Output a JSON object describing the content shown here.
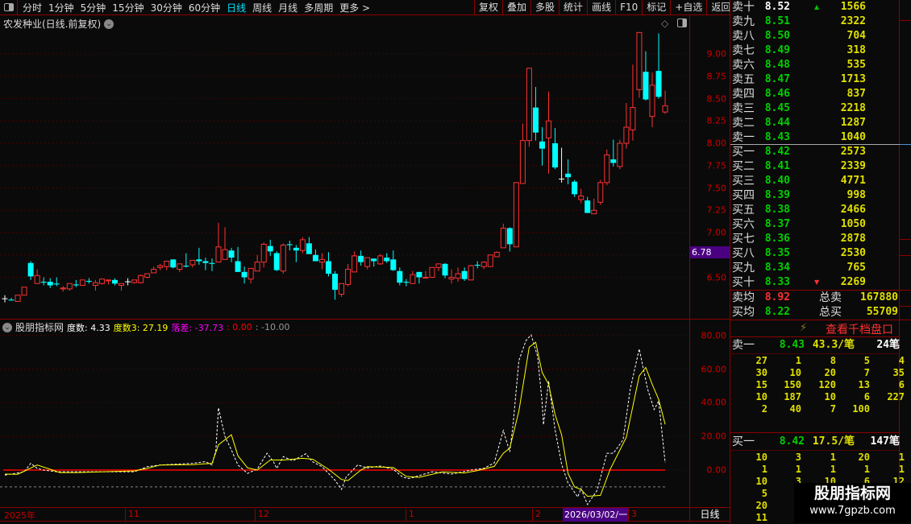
{
  "toolbar": {
    "periods": [
      "分时",
      "1分钟",
      "5分钟",
      "15分钟",
      "30分钟",
      "60分钟",
      "日线",
      "周线",
      "月线",
      "多周期",
      "更多 >"
    ],
    "active_period": "日线",
    "buttons": [
      "复权",
      "叠加",
      "多股",
      "统计",
      "画线",
      "F10",
      "标记",
      "+自选",
      "返回"
    ]
  },
  "chart": {
    "title": "农发种业(日线.前复权)",
    "price_ticks": [
      "9.00",
      "8.75",
      "8.50",
      "8.25",
      "8.00",
      "7.75",
      "7.50",
      "7.25",
      "7.00",
      "6.75",
      "6.50"
    ],
    "price_tick_values": [
      9.0,
      8.75,
      8.5,
      8.25,
      8.0,
      7.75,
      7.5,
      7.25,
      7.0,
      6.75,
      6.5
    ],
    "current_price_label": "6.78",
    "current_price_value": 6.78,
    "colors": {
      "up": "#ff3232",
      "down": "#00ffff",
      "flat": "#ffffff"
    },
    "candles_ohlc": [
      [
        6.26,
        6.3,
        6.22,
        6.26
      ],
      [
        6.25,
        6.27,
        6.24,
        6.24
      ],
      [
        6.23,
        6.3,
        6.23,
        6.3
      ],
      [
        6.3,
        6.39,
        6.3,
        6.39
      ],
      [
        6.66,
        6.68,
        6.47,
        6.51
      ],
      [
        6.43,
        6.59,
        6.43,
        6.52
      ],
      [
        6.45,
        6.5,
        6.41,
        6.44
      ],
      [
        6.45,
        6.49,
        6.38,
        6.41
      ],
      [
        6.43,
        6.5,
        6.4,
        6.42
      ],
      [
        6.37,
        6.4,
        6.34,
        6.38
      ],
      [
        6.37,
        6.43,
        6.35,
        6.43
      ],
      [
        6.42,
        6.47,
        6.39,
        6.41
      ],
      [
        6.41,
        6.47,
        6.41,
        6.47
      ],
      [
        6.46,
        6.49,
        6.43,
        6.45
      ],
      [
        6.41,
        6.47,
        6.35,
        6.44
      ],
      [
        6.43,
        6.48,
        6.42,
        6.48
      ],
      [
        6.46,
        6.47,
        6.42,
        6.47
      ],
      [
        6.47,
        6.49,
        6.41,
        6.43
      ],
      [
        6.41,
        6.43,
        6.35,
        6.43
      ],
      [
        6.45,
        6.49,
        6.41,
        6.45
      ],
      [
        6.44,
        6.47,
        6.43,
        6.47
      ],
      [
        6.44,
        6.53,
        6.43,
        6.52
      ],
      [
        6.5,
        6.54,
        6.49,
        6.54
      ],
      [
        6.55,
        6.62,
        6.55,
        6.59
      ],
      [
        6.61,
        6.65,
        6.58,
        6.63
      ],
      [
        6.62,
        6.68,
        6.58,
        6.68
      ],
      [
        6.7,
        6.7,
        6.6,
        6.61
      ],
      [
        6.59,
        6.65,
        6.56,
        6.65
      ],
      [
        6.63,
        6.77,
        6.61,
        6.62
      ],
      [
        6.64,
        6.69,
        6.61,
        6.69
      ],
      [
        6.7,
        6.83,
        6.64,
        6.68
      ],
      [
        6.68,
        6.72,
        6.58,
        6.66
      ],
      [
        6.66,
        6.71,
        6.57,
        6.65
      ],
      [
        6.67,
        7.11,
        6.67,
        6.84
      ],
      [
        6.7,
        7.06,
        6.7,
        6.81
      ],
      [
        6.8,
        6.83,
        6.67,
        6.72
      ],
      [
        6.68,
        6.84,
        6.56,
        6.56
      ],
      [
        6.56,
        6.62,
        6.43,
        6.5
      ],
      [
        6.48,
        6.6,
        6.43,
        6.6
      ],
      [
        6.57,
        6.75,
        6.57,
        6.67
      ],
      [
        6.67,
        6.89,
        6.61,
        6.87
      ],
      [
        6.85,
        6.92,
        6.74,
        6.79
      ],
      [
        6.77,
        6.79,
        6.57,
        6.58
      ],
      [
        6.57,
        6.88,
        6.54,
        6.86
      ],
      [
        6.87,
        6.91,
        6.8,
        6.86
      ],
      [
        6.83,
        6.86,
        6.67,
        6.8
      ],
      [
        6.8,
        6.95,
        6.77,
        6.92
      ],
      [
        6.88,
        6.95,
        6.76,
        6.76
      ],
      [
        6.75,
        6.81,
        6.68,
        6.68
      ],
      [
        6.67,
        6.77,
        6.59,
        6.7
      ],
      [
        6.68,
        6.78,
        6.51,
        6.54
      ],
      [
        6.54,
        6.57,
        6.25,
        6.36
      ],
      [
        6.31,
        6.43,
        6.28,
        6.43
      ],
      [
        6.42,
        6.65,
        6.4,
        6.59
      ],
      [
        6.56,
        6.79,
        6.56,
        6.74
      ],
      [
        6.74,
        6.8,
        6.63,
        6.67
      ],
      [
        6.62,
        6.72,
        6.59,
        6.72
      ],
      [
        6.71,
        6.71,
        6.62,
        6.68
      ],
      [
        6.65,
        6.76,
        6.64,
        6.74
      ],
      [
        6.72,
        6.77,
        6.66,
        6.68
      ],
      [
        6.7,
        6.8,
        6.57,
        6.58
      ],
      [
        6.57,
        6.61,
        6.41,
        6.44
      ],
      [
        6.45,
        6.48,
        6.4,
        6.44
      ],
      [
        6.43,
        6.57,
        6.43,
        6.53
      ],
      [
        6.56,
        6.56,
        6.43,
        6.5
      ],
      [
        6.49,
        6.57,
        6.49,
        6.5
      ],
      [
        6.5,
        6.61,
        6.5,
        6.61
      ],
      [
        6.61,
        6.65,
        6.57,
        6.65
      ],
      [
        6.65,
        6.66,
        6.49,
        6.52
      ],
      [
        6.48,
        6.59,
        6.43,
        6.5
      ],
      [
        6.49,
        6.61,
        6.45,
        6.54
      ],
      [
        6.57,
        6.61,
        6.46,
        6.48
      ],
      [
        6.47,
        6.64,
        6.47,
        6.63
      ],
      [
        6.64,
        6.68,
        6.6,
        6.63
      ],
      [
        6.62,
        6.68,
        6.59,
        6.67
      ],
      [
        6.62,
        6.75,
        6.62,
        6.75
      ],
      [
        6.73,
        6.79,
        6.73,
        6.78
      ],
      [
        6.83,
        7.1,
        6.83,
        7.05
      ],
      [
        7.05,
        7.06,
        6.79,
        6.87
      ],
      [
        6.84,
        7.56,
        6.84,
        7.56
      ],
      [
        7.55,
        8.22,
        7.55,
        8.03
      ],
      [
        8.03,
        8.84,
        7.96,
        8.84
      ],
      [
        8.4,
        8.63,
        8.03,
        8.12
      ],
      [
        8.02,
        8.18,
        7.75,
        7.94
      ],
      [
        8.06,
        8.58,
        7.66,
        8.25
      ],
      [
        8.0,
        8.17,
        7.71,
        7.73
      ],
      [
        7.6,
        7.95,
        7.56,
        7.6
      ],
      [
        7.66,
        7.82,
        7.54,
        7.62
      ],
      [
        7.57,
        7.59,
        7.4,
        7.43
      ],
      [
        7.37,
        7.49,
        7.33,
        7.41
      ],
      [
        7.36,
        7.4,
        7.22,
        7.22
      ],
      [
        7.21,
        7.38,
        7.21,
        7.25
      ],
      [
        7.34,
        7.59,
        7.31,
        7.56
      ],
      [
        7.56,
        7.93,
        7.53,
        7.87
      ],
      [
        7.82,
        8.04,
        7.74,
        7.78
      ],
      [
        7.74,
        8.04,
        7.71,
        8.0
      ],
      [
        8.0,
        8.45,
        7.94,
        8.18
      ],
      [
        8.15,
        8.88,
        8.03,
        8.4
      ],
      [
        8.6,
        9.24,
        8.51,
        9.24
      ],
      [
        8.8,
        9.03,
        8.48,
        8.49
      ],
      [
        8.3,
        8.79,
        8.18,
        8.65
      ],
      [
        8.81,
        9.23,
        8.5,
        8.52
      ],
      [
        8.35,
        8.59,
        8.33,
        8.42
      ]
    ]
  },
  "indicator": {
    "name": "股朋指标网",
    "items": [
      {
        "text": "度数: 4.33",
        "color": "#ffffff"
      },
      {
        "text": "度数3: 27.19",
        "color": "#ffff00"
      },
      {
        "text": "落差: -37.73",
        "color": "#ff00ff"
      },
      {
        "text": ": 0.00",
        "color": "#ff0000"
      },
      {
        "text": ": -10.00",
        "color": "#999999"
      }
    ],
    "ticks": [
      "80.00",
      "60.00",
      "40.00",
      "20.00",
      "0.00"
    ],
    "tick_values": [
      80,
      60,
      40,
      20,
      0
    ],
    "baseline_value": 0,
    "lower_level": -10,
    "degree_keypoints": [
      [
        0,
        -3
      ],
      [
        3,
        -1
      ],
      [
        4,
        4
      ],
      [
        5,
        1
      ],
      [
        6,
        0
      ],
      [
        8,
        -1
      ],
      [
        20,
        -1
      ],
      [
        22,
        2
      ],
      [
        24,
        3
      ],
      [
        29,
        4
      ],
      [
        31,
        5
      ],
      [
        32,
        3
      ],
      [
        32.6,
        12
      ],
      [
        33,
        37
      ],
      [
        34,
        20
      ],
      [
        35,
        12
      ],
      [
        36,
        3
      ],
      [
        37.5,
        -2
      ],
      [
        39,
        0.7
      ],
      [
        40.5,
        10
      ],
      [
        41.5,
        5
      ],
      [
        42,
        1
      ],
      [
        43,
        8
      ],
      [
        44.5,
        5.5
      ],
      [
        46.5,
        9.7
      ],
      [
        47.5,
        5
      ],
      [
        49,
        2
      ],
      [
        51,
        -6
      ],
      [
        52,
        -11.5
      ],
      [
        52.7,
        -4.3
      ],
      [
        54.5,
        3
      ],
      [
        56,
        1.3
      ],
      [
        58,
        2.4
      ],
      [
        60,
        0.5
      ],
      [
        61.5,
        -4.3
      ],
      [
        62.5,
        -5
      ],
      [
        66,
        -1
      ],
      [
        69,
        -2.4
      ],
      [
        72,
        0
      ],
      [
        74,
        1
      ],
      [
        75.6,
        4.3
      ],
      [
        77,
        23.5
      ],
      [
        78,
        10.8
      ],
      [
        78.5,
        27
      ],
      [
        79.4,
        65
      ],
      [
        80.5,
        77
      ],
      [
        81.3,
        80.4
      ],
      [
        82.3,
        67.4
      ],
      [
        83,
        40
      ],
      [
        83.2,
        27
      ],
      [
        84,
        53
      ],
      [
        85,
        24
      ],
      [
        86,
        3.5
      ],
      [
        87,
        -7.7
      ],
      [
        88.5,
        -16
      ],
      [
        89,
        -11
      ],
      [
        90,
        -20.5
      ],
      [
        91.5,
        -12
      ],
      [
        93,
        10
      ],
      [
        94,
        10
      ],
      [
        95.5,
        18
      ],
      [
        96.6,
        48
      ],
      [
        98,
        72
      ],
      [
        99.3,
        48
      ],
      [
        100.3,
        36
      ],
      [
        101,
        41
      ],
      [
        102,
        4.33
      ]
    ],
    "degree3_keypoints": [
      [
        0,
        -2.4
      ],
      [
        2,
        -2.5
      ],
      [
        5,
        3
      ],
      [
        7,
        0.5
      ],
      [
        8.5,
        -1.5
      ],
      [
        11,
        -1.5
      ],
      [
        20,
        -0.5
      ],
      [
        22,
        1
      ],
      [
        24,
        3
      ],
      [
        29,
        3.2
      ],
      [
        32,
        4
      ],
      [
        33,
        15
      ],
      [
        35,
        21
      ],
      [
        36,
        8.5
      ],
      [
        37.5,
        1.3
      ],
      [
        39,
        0
      ],
      [
        41,
        6
      ],
      [
        43,
        6
      ],
      [
        46,
        7
      ],
      [
        47.6,
        6.4
      ],
      [
        50,
        0.5
      ],
      [
        52,
        -5.6
      ],
      [
        53,
        -6.2
      ],
      [
        55,
        0
      ],
      [
        56,
        2
      ],
      [
        60,
        1.6
      ],
      [
        62,
        -3.8
      ],
      [
        64,
        -4.3
      ],
      [
        67.6,
        -1.1
      ],
      [
        71,
        -1.7
      ],
      [
        73,
        -0.3
      ],
      [
        75.6,
        2.2
      ],
      [
        77,
        10
      ],
      [
        78,
        13
      ],
      [
        79.4,
        35
      ],
      [
        81,
        73
      ],
      [
        82,
        76
      ],
      [
        83,
        58
      ],
      [
        84,
        51
      ],
      [
        85,
        33
      ],
      [
        86,
        21
      ],
      [
        87,
        -2
      ],
      [
        88,
        -10
      ],
      [
        89,
        -11.6
      ],
      [
        90,
        -15.6
      ],
      [
        92,
        -15
      ],
      [
        93.5,
        0.4
      ],
      [
        96,
        19.5
      ],
      [
        98,
        56
      ],
      [
        99,
        61
      ],
      [
        100,
        51
      ],
      [
        101,
        42
      ],
      [
        102,
        27.19
      ]
    ]
  },
  "xaxis": {
    "labels": [
      {
        "text": "2025年"
      },
      {
        "text": "11"
      },
      {
        "text": "12"
      },
      {
        "text": "1"
      },
      {
        "text": "2"
      },
      {
        "text": "3"
      }
    ],
    "cursor_date": "2026/03/02/一",
    "period": "日线"
  },
  "orderbook": {
    "asks": [
      {
        "label": "卖十",
        "price": "8.52",
        "vol": "1566",
        "arrow": "▲",
        "price_color": "#ffffff",
        "arrow_color": "#00c000"
      },
      {
        "label": "卖九",
        "price": "8.51",
        "vol": "2322"
      },
      {
        "label": "卖八",
        "price": "8.50",
        "vol": "704"
      },
      {
        "label": "卖七",
        "price": "8.49",
        "vol": "318"
      },
      {
        "label": "卖六",
        "price": "8.48",
        "vol": "535"
      },
      {
        "label": "卖五",
        "price": "8.47",
        "vol": "1713"
      },
      {
        "label": "卖四",
        "price": "8.46",
        "vol": "837"
      },
      {
        "label": "卖三",
        "price": "8.45",
        "vol": "2218"
      },
      {
        "label": "卖二",
        "price": "8.44",
        "vol": "1287"
      },
      {
        "label": "卖一",
        "price": "8.43",
        "vol": "1040"
      }
    ],
    "bids": [
      {
        "label": "买一",
        "price": "8.42",
        "vol": "2573"
      },
      {
        "label": "买二",
        "price": "8.41",
        "vol": "2339"
      },
      {
        "label": "买三",
        "price": "8.40",
        "vol": "4771"
      },
      {
        "label": "买四",
        "price": "8.39",
        "vol": "998"
      },
      {
        "label": "买五",
        "price": "8.38",
        "vol": "2466"
      },
      {
        "label": "买六",
        "price": "8.37",
        "vol": "1050"
      },
      {
        "label": "买七",
        "price": "8.36",
        "vol": "2878"
      },
      {
        "label": "买八",
        "price": "8.35",
        "vol": "2530"
      },
      {
        "label": "买九",
        "price": "8.34",
        "vol": "765"
      },
      {
        "label": "买十",
        "price": "8.33",
        "vol": "2269",
        "arrow": "▼",
        "arrow_color": "#ff3030"
      }
    ],
    "ask_avg_label": "卖均",
    "ask_avg": "8.92",
    "total_ask_label": "总卖",
    "total_ask": "167880",
    "bid_avg_label": "买均",
    "bid_avg": "8.22",
    "total_bid_label": "总买",
    "total_bid": "55709",
    "deep_book_link": "查看千档盘口",
    "ask1_queue": {
      "label": "卖一",
      "price": "8.43",
      "avg": "43.3/笔",
      "count": "24笔",
      "rows": [
        [
          "27",
          "1",
          "8",
          "5",
          "4"
        ],
        [
          "30",
          "10",
          "20",
          "7",
          "35"
        ],
        [
          "15",
          "150",
          "120",
          "13",
          "6"
        ],
        [
          "10",
          "187",
          "10",
          "6",
          "227"
        ],
        [
          "2",
          "40",
          "7",
          "100",
          ""
        ]
      ]
    },
    "bid1_queue": {
      "label": "买一",
      "price": "8.42",
      "avg": "17.5/笔",
      "count": "147笔",
      "rows": [
        [
          "10",
          "3",
          "1",
          "20",
          "1"
        ],
        [
          "1",
          "1",
          "1",
          "1",
          "1"
        ],
        [
          "10",
          "3",
          "10",
          "6",
          "12"
        ],
        [
          "5",
          "",
          "",
          "",
          ""
        ],
        [
          "20",
          "",
          "",
          "",
          ""
        ],
        [
          "11",
          "1",
          "",
          "",
          ""
        ]
      ]
    }
  },
  "watermark": {
    "title": "股朋指标网",
    "url": "www.7gpzb.com"
  }
}
